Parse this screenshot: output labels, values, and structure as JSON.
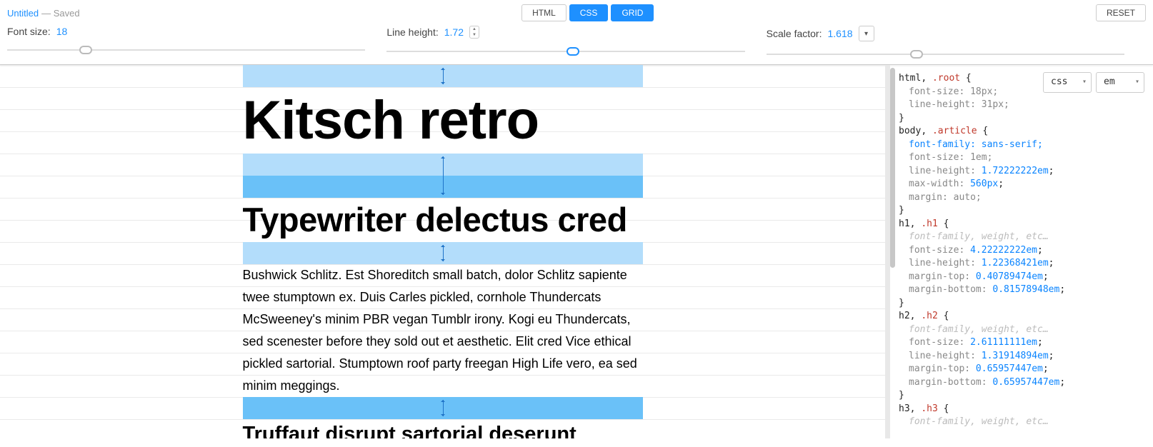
{
  "header": {
    "title": "Untitled",
    "saved": "— Saved",
    "tabs": {
      "html": "HTML",
      "css": "CSS",
      "grid": "GRID"
    },
    "reset": "RESET"
  },
  "controls": {
    "fontSize": {
      "label": "Font size:",
      "value": "18",
      "sliderPos": 22
    },
    "lineHeight": {
      "label": "Line height:",
      "value": "1.72",
      "sliderPos": 52
    },
    "scaleFactor": {
      "label": "Scale factor:",
      "value": "1.618",
      "sliderPos": 42
    }
  },
  "article": {
    "h1": "Kitsch retro",
    "h2": "Typewriter delectus cred",
    "p1": "Bushwick Schlitz. Est Shoreditch small batch, dolor Schlitz sapiente twee stumptown ex. Duis Carles pickled, cornhole Thundercats McSweeney's minim PBR vegan Tumblr irony. Kogi eu Thundercats, sed scenester before they sold out et aesthetic. Elit cred Vice ethical pickled sartorial. Stumptown roof party freegan High Life vero, ea sed minim meggings.",
    "h3": "Truffaut disrupt sartorial deserunt"
  },
  "codePanel": {
    "formatSelect": "css",
    "unitSelect": "em"
  },
  "codeText": {
    "l1a": "html",
    "l1b": ", ",
    "l1c": ".root",
    "l1d": " {",
    "l2": "font-size: 18px;",
    "l3": "line-height: 31px;",
    "l4": "}",
    "l5a": "body",
    "l5b": ", ",
    "l5c": ".article",
    "l5d": " {",
    "l6": "font-family: sans-serif;",
    "l7": "font-size: 1em;",
    "l8a": "line-height: ",
    "l8b": "1.72222222em",
    "l8c": ";",
    "l9a": "max-width: ",
    "l9b": "560px",
    "l9c": ";",
    "l10": "margin: auto;",
    "l11": "}",
    "l12a": "h1",
    "l12b": ", ",
    "l12c": ".h1",
    "l12d": " {",
    "l13": "font-family, weight, etc…",
    "l14a": "font-size: ",
    "l14b": "4.22222222em",
    "l14c": ";",
    "l15a": "line-height: ",
    "l15b": "1.22368421em",
    "l15c": ";",
    "l16a": "margin-top: ",
    "l16b": "0.40789474em",
    "l16c": ";",
    "l17a": "margin-bottom: ",
    "l17b": "0.81578948em",
    "l17c": ";",
    "l18": "}",
    "l19a": "h2",
    "l19b": ", ",
    "l19c": ".h2",
    "l19d": " {",
    "l20": "font-family, weight, etc…",
    "l21a": "font-size: ",
    "l21b": "2.61111111em",
    "l21c": ";",
    "l22a": "line-height: ",
    "l22b": "1.31914894em",
    "l22c": ";",
    "l23a": "margin-top: ",
    "l23b": "0.65957447em",
    "l23c": ";",
    "l24a": "margin-bottom: ",
    "l24b": "0.65957447em",
    "l24c": ";",
    "l25": "}",
    "l26a": "h3",
    "l26b": ", ",
    "l26c": ".h3",
    "l26d": " {",
    "l27": "font-family, weight, etc…"
  }
}
